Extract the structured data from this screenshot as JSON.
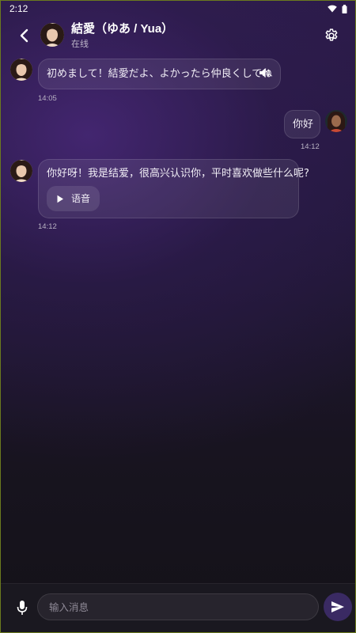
{
  "status_bar": {
    "time": "2:12"
  },
  "header": {
    "title": "結愛（ゆあ / Yua）",
    "status": "在线"
  },
  "messages": [
    {
      "sender": "bot",
      "text": "初めまして！結愛だよ、よかったら仲良くしてね",
      "time": "14:05",
      "has_speaker": true
    },
    {
      "sender": "user",
      "text": "你好",
      "time": "14:12"
    },
    {
      "sender": "bot",
      "text": "你好呀！我是结爱，很高兴认识你，平时喜欢做些什么呢?",
      "time": "14:12",
      "voice_label": "语音"
    }
  ],
  "input": {
    "placeholder": "输入消息"
  },
  "colors": {
    "accent": "#3a2a63",
    "bg_top": "#2b1b48",
    "bg_bottom": "#141218"
  },
  "icons": [
    "back-arrow-icon",
    "settings-gear-icon",
    "speaker-icon",
    "play-icon",
    "mic-icon",
    "send-icon",
    "wifi-icon",
    "battery-icon"
  ]
}
